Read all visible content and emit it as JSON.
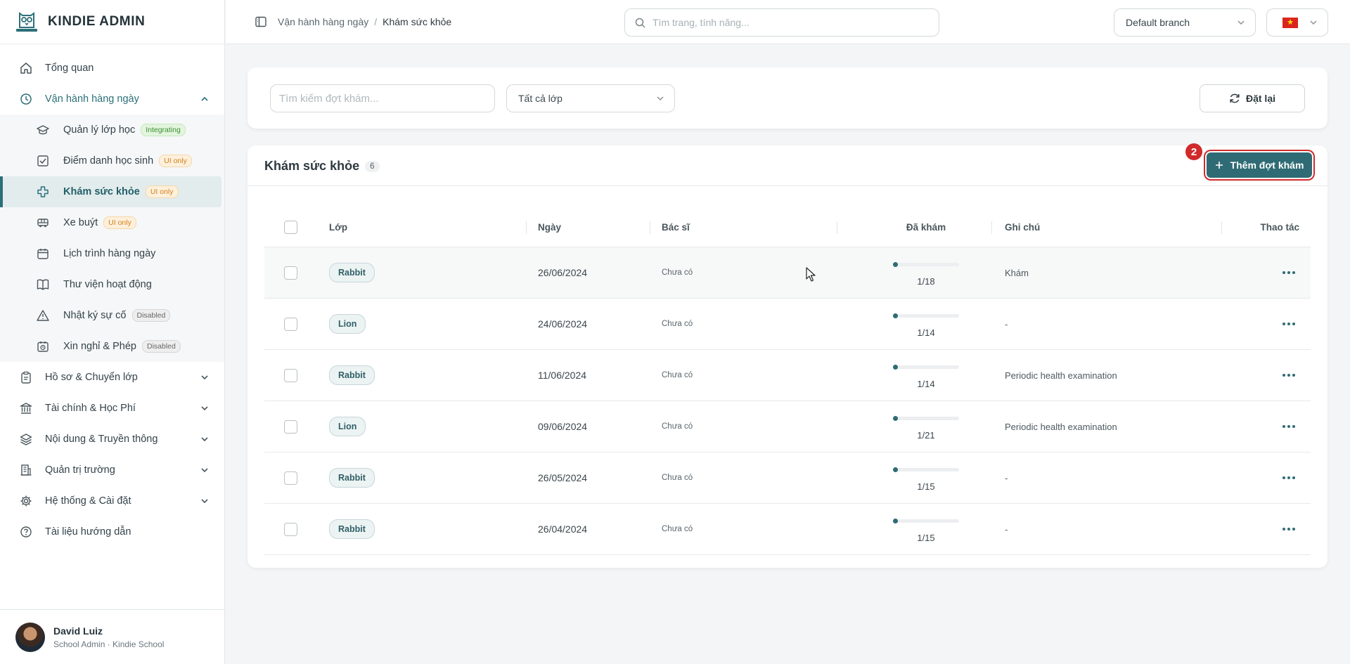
{
  "app": {
    "brand": "KINDIE ADMIN"
  },
  "sidebar": {
    "items": [
      {
        "label": "Tổng quan",
        "icon": "home-icon"
      },
      {
        "label": "Vận hành hàng ngày",
        "icon": "clock-icon",
        "expanded": true
      },
      {
        "label": "Hồ sơ & Chuyển lớp",
        "icon": "clipboard-icon"
      },
      {
        "label": "Tài chính & Học Phí",
        "icon": "bank-icon"
      },
      {
        "label": "Nội dung & Truyền thông",
        "icon": "layers-icon"
      },
      {
        "label": "Quản trị trường",
        "icon": "building-icon"
      },
      {
        "label": "Hệ thống & Cài đặt",
        "icon": "gear-icon"
      },
      {
        "label": "Tài liệu hướng dẫn",
        "icon": "help-icon"
      }
    ],
    "sub_items": [
      {
        "label": "Quản lý lớp học",
        "badge": "Integrating",
        "icon": "graduation-cap-icon"
      },
      {
        "label": "Điểm danh học sinh",
        "badge": "UI only",
        "icon": "checkbox-icon"
      },
      {
        "label": "Khám sức khỏe",
        "badge": "UI only",
        "icon": "medical-cross-icon",
        "active": true
      },
      {
        "label": "Xe buýt",
        "badge": "UI only",
        "icon": "bus-icon"
      },
      {
        "label": "Lịch trình hàng ngày",
        "badge": "",
        "icon": "calendar-icon"
      },
      {
        "label": "Thư viện hoạt động",
        "badge": "",
        "icon": "book-icon"
      },
      {
        "label": "Nhật ký sự cố",
        "badge": "Disabled",
        "icon": "warning-icon"
      },
      {
        "label": "Xin nghỉ & Phép",
        "badge": "Disabled",
        "icon": "calendar-clock-icon"
      }
    ],
    "user": {
      "name": "David Luiz",
      "role": "School Admin · Kindie School"
    }
  },
  "header": {
    "breadcrumb": {
      "parent": "Vận hành hàng ngày",
      "separator": "/",
      "current": "Khám sức khỏe"
    },
    "search_placeholder": "Tìm trang, tính năng...",
    "branch": "Default branch",
    "language_flag": "vietnam-flag-icon"
  },
  "filters": {
    "search_placeholder": "Tìm kiếm đợt khám...",
    "class_select": "Tất cả lớp",
    "reset_label": "Đặt lại"
  },
  "table": {
    "title": "Khám sức khỏe",
    "count": "6",
    "add_label": "Thêm đợt khám",
    "step_marker": "2",
    "columns": {
      "class": "Lớp",
      "date": "Ngày",
      "doctor": "Bác sĩ",
      "done": "Đã khám",
      "note": "Ghi chú",
      "actions": "Thao tác"
    },
    "rows": [
      {
        "class": "Rabbit",
        "date": "26/06/2024",
        "doctor": "Chưa có",
        "done": "1/18",
        "progress": 0.056,
        "note": "Khám"
      },
      {
        "class": "Lion",
        "date": "24/06/2024",
        "doctor": "Chưa có",
        "done": "1/14",
        "progress": 0.071,
        "note": "-"
      },
      {
        "class": "Rabbit",
        "date": "11/06/2024",
        "doctor": "Chưa có",
        "done": "1/14",
        "progress": 0.071,
        "note": "Periodic health examination"
      },
      {
        "class": "Lion",
        "date": "09/06/2024",
        "doctor": "Chưa có",
        "done": "1/21",
        "progress": 0.048,
        "note": "Periodic health examination"
      },
      {
        "class": "Rabbit",
        "date": "26/05/2024",
        "doctor": "Chưa có",
        "done": "1/15",
        "progress": 0.067,
        "note": "-"
      },
      {
        "class": "Rabbit",
        "date": "26/04/2024",
        "doctor": "Chưa có",
        "done": "1/15",
        "progress": 0.067,
        "note": "-"
      }
    ]
  },
  "colors": {
    "accent": "#2f6b74",
    "highlight": "#d02a2a"
  }
}
